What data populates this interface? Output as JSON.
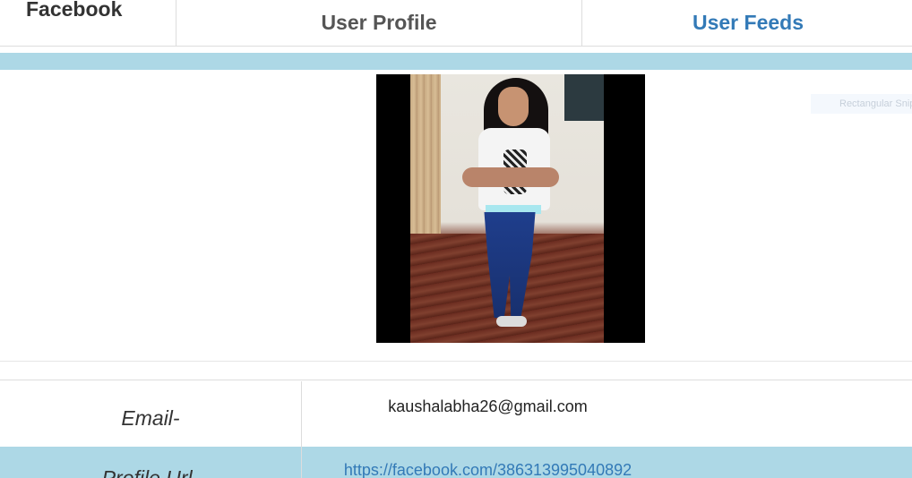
{
  "tabs": {
    "facebook": "Facebook",
    "user_profile": "User Profile",
    "user_feeds": "User Feeds"
  },
  "snip": {
    "label": "Rectangular Snip"
  },
  "profile": {
    "email_label": "Email-",
    "email_value": "kaushalabha26@gmail.com",
    "url_label": "Profile Url-",
    "url_value": "https://facebook.com/386313995040892"
  },
  "colors": {
    "strip": "#add8e6",
    "link": "#337ab7"
  }
}
